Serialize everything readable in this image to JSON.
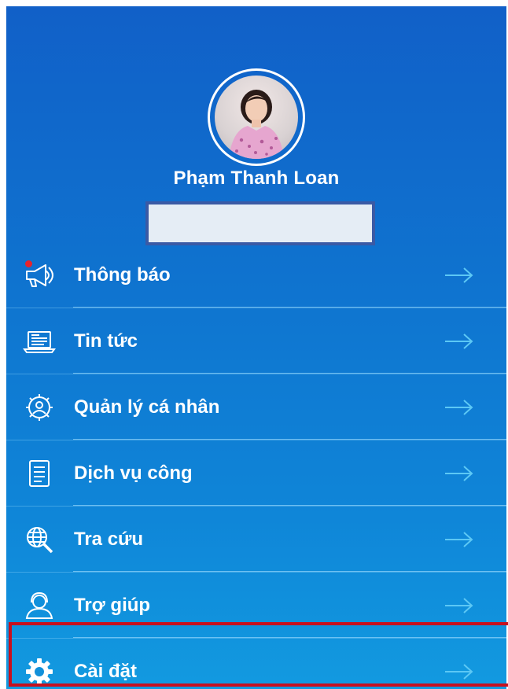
{
  "profile": {
    "name": "Phạm Thanh Loan"
  },
  "menu": {
    "items": [
      {
        "label": "Thông báo",
        "icon": "megaphone-icon",
        "has_notification": true
      },
      {
        "label": "Tin tức",
        "icon": "news-laptop-icon"
      },
      {
        "label": "Quản lý cá nhân",
        "icon": "person-gear-icon"
      },
      {
        "label": "Dịch vụ công",
        "icon": "document-list-icon"
      },
      {
        "label": "Tra cứu",
        "icon": "globe-search-icon"
      },
      {
        "label": "Trợ giúp",
        "icon": "support-agent-icon"
      },
      {
        "label": "Cài đặt",
        "icon": "settings-gear-icon",
        "highlighted": true
      }
    ]
  },
  "colors": {
    "background_top": "#1160c8",
    "background_bottom": "#129ae0",
    "text": "#ffffff",
    "arrow": "#5cc8f5",
    "notification_dot": "#e8232b",
    "highlight_border": "#c8101e"
  }
}
